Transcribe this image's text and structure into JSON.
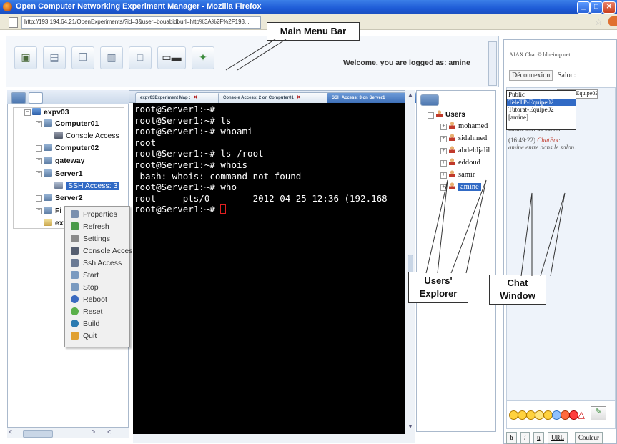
{
  "window": {
    "title": "Open Computer Networking Experiment Manager - Mozilla Firefox",
    "url": "http://193.194.64.21/OpenExperiments/?id=3&user=bouabidburl=http%3A%2F%2F193..."
  },
  "annotations": {
    "main_menu_bar": "Main Menu Bar",
    "users_explorer": "Users' Explorer",
    "chat_window": "Chat Window"
  },
  "menu": {
    "toolbar_icons": [
      "save-icon",
      "new-file-icon",
      "copy-icon",
      "paste-icon",
      "window-icon",
      "devices-icon",
      "network-icon"
    ],
    "welcome": "Welcome, you are logged as: amine"
  },
  "tree": {
    "root": "expv03",
    "nodes": [
      "Computer01",
      "Console Access",
      "Computer02",
      "gateway",
      "Server1",
      "SSH Access: 3",
      "Server2",
      "Fi",
      "ex"
    ]
  },
  "context_menu": [
    "Properties",
    "Refresh",
    "Settings",
    "Console Access",
    "Ssh Access",
    "Start",
    "Stop",
    "Reboot",
    "Reset",
    "Build",
    "Quit"
  ],
  "terminal": {
    "tabs": [
      "expv03Experiment Map :",
      "Console Access: 2 on Computer01",
      "SSH Access: 3 on Server1"
    ],
    "lines": [
      "root@Server1:~#",
      "root@Server1:~# ls",
      "root@Server1:~# whoami",
      "root",
      "root@Server1:~# ls /root",
      "root@Server1:~# whois",
      "-bash: whois: command not found",
      "root@Server1:~# who",
      "root     pts/0        2012-04-25 12:36 (192.168",
      "root@Server1:~# "
    ]
  },
  "users": {
    "group": "Users",
    "list": [
      "mohamed",
      "sidahmed",
      "abdeldjalil",
      "eddoud",
      "samir",
      "amine"
    ],
    "selected": "amine"
  },
  "chat": {
    "title": "AJAX Chat © blueimp.net",
    "logout": "Déconnexion",
    "salon_label": "Salon:",
    "selected_channel": "TeleTP-Equipe02",
    "channels": [
      "Public",
      "TeleTP-Equipe02",
      "Tutorat-Equipe02",
      "[amine]"
    ],
    "msg1_text": "amine sort du salon.",
    "msg2_time": "(16:49:22)",
    "msg2_bot": "ChatBot",
    "msg2_text": "amine entre dans le salon.",
    "format_buttons": [
      "b",
      "i",
      "u",
      "URL",
      "Couleur"
    ]
  },
  "colors": {
    "titlebar": "#1d5ad6",
    "selection": "#316ac5",
    "terminal_bg": "#000000",
    "cursor": "#e02020"
  }
}
